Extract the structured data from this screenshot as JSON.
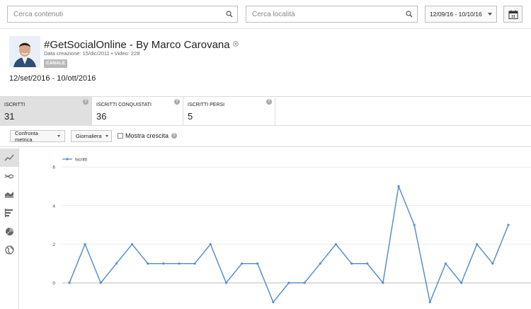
{
  "search": {
    "content_placeholder": "Cerca contenuti",
    "location_placeholder": "Cerca località"
  },
  "date_range": {
    "label": "12/09/16 - 10/10/16",
    "calendar_day": "31"
  },
  "channel": {
    "name": "#GetSocialOnline - By Marco Carovana",
    "meta": "Data creazione: 15/dic/2011 • Video: 228",
    "badge": "CANALE",
    "period": "12/set/2016 - 10/ott/2016"
  },
  "metrics": [
    {
      "label": "ISCRITTI",
      "value": "31"
    },
    {
      "label": "ISCRITTI CONQUISTATI",
      "value": "36"
    },
    {
      "label": "ISCRITTI PERSI",
      "value": "5"
    }
  ],
  "controls": {
    "compare_label": "Confronta metrica",
    "granularity_label": "Giornaliera",
    "growth_label": "Mostra crescita"
  },
  "chart_types": [
    "line-chart-icon",
    "multi-line-chart-icon",
    "stacked-area-chart-icon",
    "bar-chart-icon",
    "pie-chart-icon",
    "map-icon"
  ],
  "colors": {
    "series": "#5b8fc7",
    "active_tab": "#e0e0e0"
  },
  "chart_data": {
    "type": "line",
    "title": "",
    "xlabel": "",
    "ylabel": "",
    "ylim": [
      -1,
      6
    ],
    "yticks": [
      0,
      2,
      4,
      6
    ],
    "legend": "top-left",
    "grid": true,
    "series": [
      {
        "name": "Iscritti",
        "values": [
          0,
          2,
          0,
          1,
          2,
          1,
          1,
          1,
          1,
          2,
          0,
          1,
          1,
          -1,
          0,
          0,
          1,
          2,
          1,
          1,
          0,
          5,
          3,
          -1,
          1,
          0,
          2,
          1,
          3
        ]
      }
    ]
  }
}
